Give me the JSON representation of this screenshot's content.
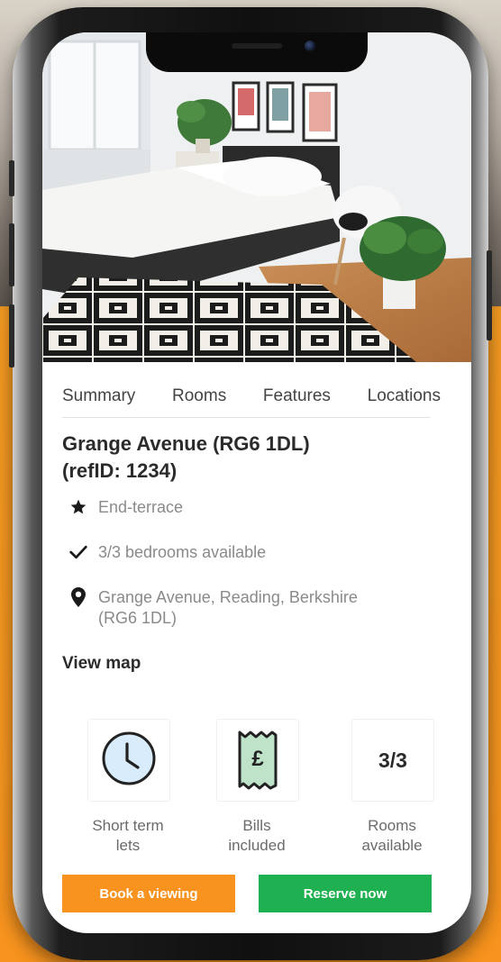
{
  "tabs": [
    "Summary",
    "Rooms",
    "Features",
    "Locations"
  ],
  "property": {
    "title_line1": "Grange Avenue (RG6 1DL)",
    "title_line2": "(refID: 1234)"
  },
  "details": [
    {
      "icon": "star-icon",
      "text": "End-terrace"
    },
    {
      "icon": "checkmark-icon",
      "text": "3/3 bedrooms available"
    },
    {
      "icon": "location-pin-icon",
      "text_line1": "Grange Avenue, Reading, Berkshire",
      "text_line2": "(RG6 1DL)"
    }
  ],
  "view_map_label": "View map",
  "features": [
    {
      "icon": "clock-icon",
      "label_line1": "Short term",
      "label_line2": "lets"
    },
    {
      "icon": "pound-receipt-icon",
      "icon_text": "£",
      "label_line1": "Bills",
      "label_line2": "included"
    },
    {
      "icon": "rooms-count",
      "value": "3/3",
      "label_line1": "Rooms",
      "label_line2": "available"
    }
  ],
  "buttons": {
    "book": "Book a viewing",
    "reserve": "Reserve now"
  },
  "colors": {
    "accent_orange": "#f7931e",
    "accent_green": "#1fb151",
    "pound_fill": "#bfe3c8",
    "clock_fill": "#d8ecfb"
  }
}
